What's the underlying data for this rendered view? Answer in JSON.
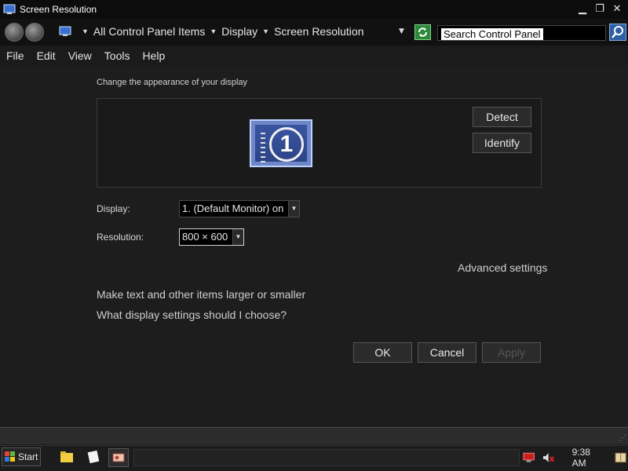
{
  "window": {
    "title": "Screen Resolution",
    "controls": {
      "minimize": "▁",
      "restore": "❐",
      "close": "✕"
    }
  },
  "address": {
    "crumbs": [
      "All Control Panel Items",
      "Display",
      "Screen Resolution"
    ],
    "search_placeholder": "Search Control Panel"
  },
  "menu": [
    "File",
    "Edit",
    "View",
    "Tools",
    "Help"
  ],
  "content": {
    "subtitle": "Change the appearance of your display",
    "monitor_number": "1",
    "detect_label": "Detect",
    "identify_label": "Identify",
    "display_label": "Display:",
    "display_value": "1. (Default Monitor) on",
    "resolution_label": "Resolution:",
    "resolution_value": "800 × 600",
    "advanced_link": "Advanced settings",
    "text_size_link": "Make text and other items larger or smaller",
    "help_link": "What display settings should I choose?"
  },
  "buttons": {
    "ok": "OK",
    "cancel": "Cancel",
    "apply": "Apply"
  },
  "taskbar": {
    "start": "Start",
    "clock": "9:38 AM"
  },
  "colors": {
    "accent": "#2d5fa6",
    "monitor": "#6f86c8",
    "background": "#1d1d1d"
  }
}
